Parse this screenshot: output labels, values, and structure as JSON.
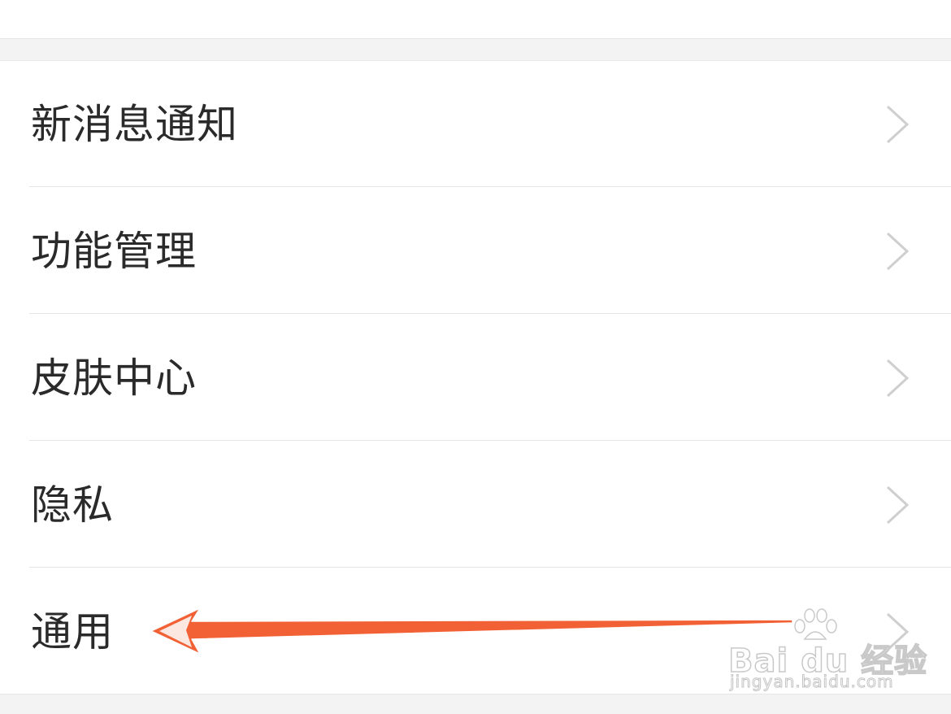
{
  "settings_list": {
    "items": [
      {
        "label": "新消息通知"
      },
      {
        "label": "功能管理"
      },
      {
        "label": "皮肤中心"
      },
      {
        "label": "隐私"
      },
      {
        "label": "通用"
      }
    ]
  },
  "annotation": {
    "arrow_color": "#f26135",
    "points_to": "通用"
  },
  "watermark": {
    "brand": "Bai du 经验",
    "url": "jingyan.baidu.com"
  },
  "icons": {
    "row_chevron": "chevron-right-icon"
  },
  "colors": {
    "background": "#f3f3f3",
    "row_background": "#ffffff",
    "label_text": "#2a2a2a",
    "chevron": "#cfcfcf",
    "divider": "#e6e6e6"
  }
}
